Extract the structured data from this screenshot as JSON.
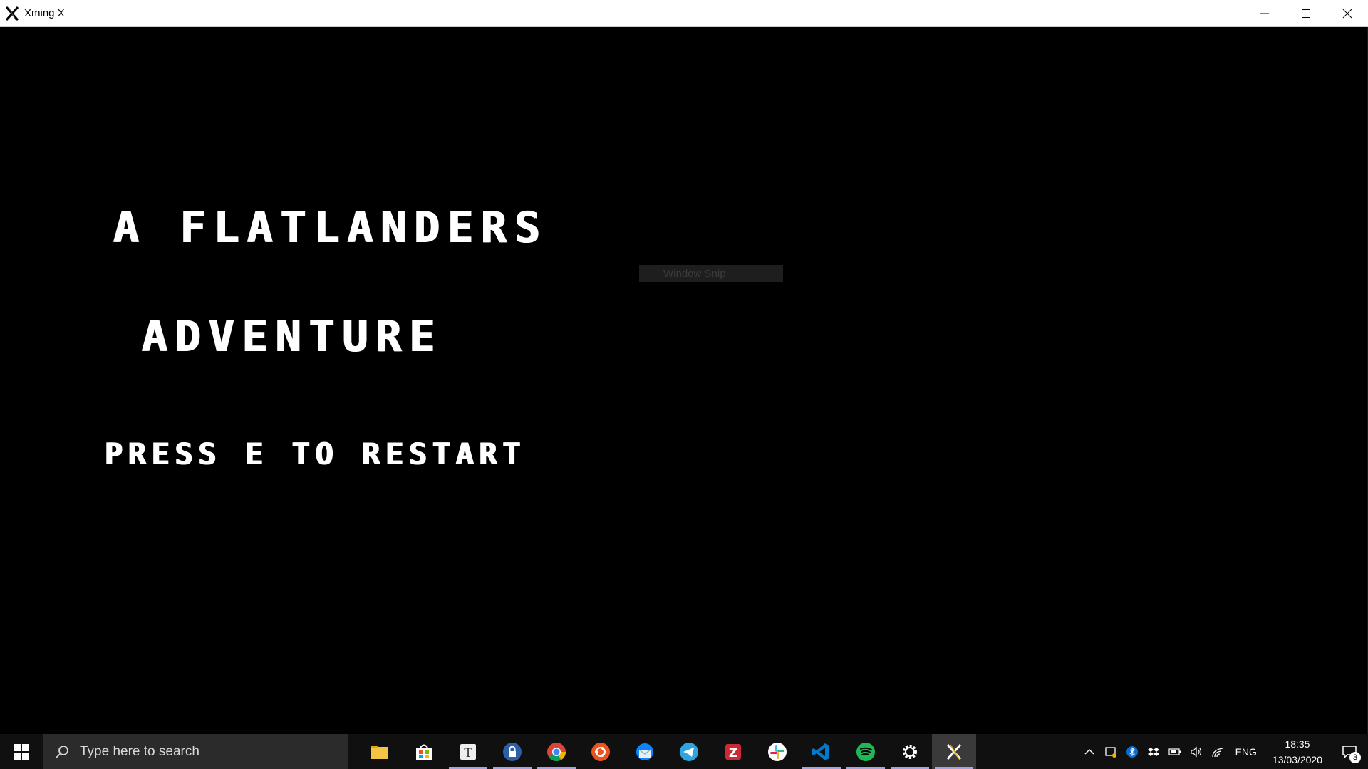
{
  "window": {
    "title": "Xming X"
  },
  "game": {
    "title_line1": "A FLATLANDERS",
    "title_line2": "ADVENTURE",
    "prompt": "PRESS E TO RESTART",
    "tooltip": "Window Snip"
  },
  "taskbar": {
    "search_placeholder": "Type here to search",
    "apps": [
      {
        "name": "file-explorer-icon"
      },
      {
        "name": "store-icon"
      },
      {
        "name": "typora-icon"
      },
      {
        "name": "keepass-icon"
      },
      {
        "name": "chrome-icon"
      },
      {
        "name": "ubuntu-icon"
      },
      {
        "name": "thunderbird-icon"
      },
      {
        "name": "telegram-icon"
      },
      {
        "name": "zotero-icon"
      },
      {
        "name": "slack-icon"
      },
      {
        "name": "vscode-icon"
      },
      {
        "name": "spotify-icon"
      },
      {
        "name": "settings-icon"
      },
      {
        "name": "xming-icon"
      }
    ],
    "language": "ENG",
    "time": "18:35",
    "date": "13/03/2020",
    "notification_count": "3"
  },
  "colors": {
    "accent": "#a3a3e0",
    "taskbar": "#101010",
    "background": "#000000"
  }
}
